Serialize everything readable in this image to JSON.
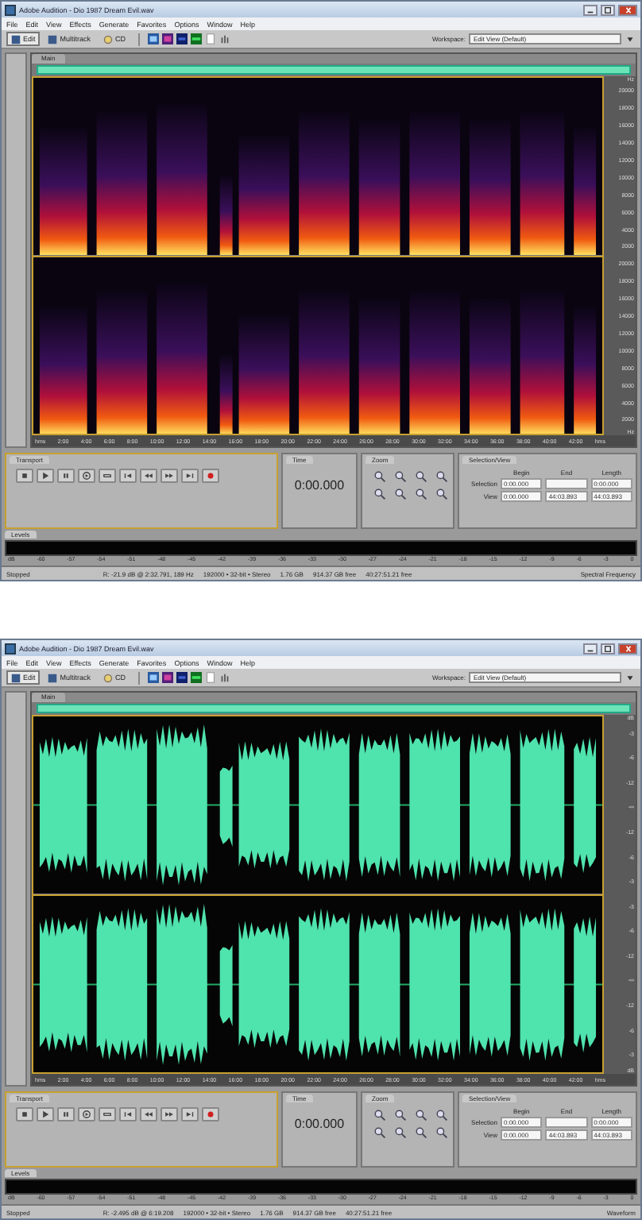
{
  "windows": [
    {
      "title": "Adobe Audition - Dio 1987 Dream Evil.wav",
      "menu": [
        "File",
        "Edit",
        "View",
        "Effects",
        "Generate",
        "Favorites",
        "Options",
        "Window",
        "Help"
      ],
      "toolbar": {
        "modes": [
          {
            "label": "Edit",
            "selected": true
          },
          {
            "label": "Multitrack",
            "selected": false
          },
          {
            "label": "CD",
            "selected": false
          }
        ],
        "workspace_label": "Workspace:",
        "workspace": "Edit View (Default)"
      },
      "main_tab": "Main",
      "display": {
        "kind": "spectral"
      },
      "axis": {
        "unit_top": "Hz",
        "unit_bottom": "Hz",
        "channels": [
          [
            "20000",
            "18000",
            "16000",
            "14000",
            "12000",
            "10000",
            "8000",
            "6000",
            "4000",
            "2000"
          ],
          [
            "20000",
            "18000",
            "16000",
            "14000",
            "12000",
            "10000",
            "8000",
            "6000",
            "4000",
            "2000"
          ]
        ]
      },
      "ruler": [
        "hms",
        "2:00",
        "4:00",
        "6:00",
        "8:00",
        "10:00",
        "12:00",
        "14:00",
        "16:00",
        "18:00",
        "20:00",
        "22:00",
        "24:00",
        "26:00",
        "28:00",
        "30:00",
        "32:00",
        "34:00",
        "36:00",
        "38:00",
        "40:00",
        "42:00",
        "hms"
      ],
      "transport": {
        "title": "Transport"
      },
      "time": {
        "title": "Time",
        "value": "0:00.000"
      },
      "zoom": {
        "title": "Zoom"
      },
      "selection": {
        "title": "Selection/View",
        "columns": [
          "Begin",
          "End",
          "Length"
        ],
        "rows": [
          {
            "label": "Selection",
            "begin": "0:00.000",
            "length": "0:00.000"
          },
          {
            "label": "View",
            "begin": "0:00.000",
            "end": "44:03.893",
            "length": "44:03.893"
          }
        ]
      },
      "levels": {
        "title": "Levels",
        "scale": [
          "dB",
          "-60",
          "-57",
          "-54",
          "-51",
          "-48",
          "-45",
          "-42",
          "-39",
          "-36",
          "-33",
          "-30",
          "-27",
          "-24",
          "-21",
          "-18",
          "-15",
          "-12",
          "-9",
          "-6",
          "-3",
          "0"
        ]
      },
      "status": [
        "Stopped",
        "R: -21.9 dB @ 2:32.791, 189 Hz",
        "192000 • 32-bit • Stereo",
        "1.76 GB",
        "914.37 GB free",
        "40:27:51.21 free",
        "Spectral Frequency"
      ]
    },
    {
      "title": "Adobe Audition - Dio 1987 Dream Evil.wav",
      "menu": [
        "File",
        "Edit",
        "View",
        "Effects",
        "Generate",
        "Favorites",
        "Options",
        "Window",
        "Help"
      ],
      "toolbar": {
        "modes": [
          {
            "label": "Edit",
            "selected": true
          },
          {
            "label": "Multitrack",
            "selected": false
          },
          {
            "label": "CD",
            "selected": false
          }
        ],
        "workspace_label": "Workspace:",
        "workspace": "Edit View (Default)"
      },
      "main_tab": "Main",
      "display": {
        "kind": "waveform"
      },
      "axis": {
        "unit_top": "dB",
        "unit_bottom": "dB",
        "channels": [
          [
            "-3",
            "-6",
            "-12",
            "-∞",
            "-12",
            "-6",
            "-3"
          ],
          [
            "-3",
            "-6",
            "-12",
            "-∞",
            "-12",
            "-6",
            "-3"
          ]
        ]
      },
      "ruler": [
        "hms",
        "2:00",
        "4:00",
        "6:00",
        "8:00",
        "10:00",
        "12:00",
        "14:00",
        "16:00",
        "18:00",
        "20:00",
        "22:00",
        "24:00",
        "26:00",
        "28:00",
        "30:00",
        "32:00",
        "34:00",
        "36:00",
        "38:00",
        "40:00",
        "42:00",
        "hms"
      ],
      "transport": {
        "title": "Transport"
      },
      "time": {
        "title": "Time",
        "value": "0:00.000"
      },
      "zoom": {
        "title": "Zoom"
      },
      "selection": {
        "title": "Selection/View",
        "columns": [
          "Begin",
          "End",
          "Length"
        ],
        "rows": [
          {
            "label": "Selection",
            "begin": "0:00.000",
            "length": "0:00.000"
          },
          {
            "label": "View",
            "begin": "0:00.000",
            "end": "44:03.893",
            "length": "44:03.893"
          }
        ]
      },
      "levels": {
        "title": "Levels",
        "scale": [
          "dB",
          "-60",
          "-57",
          "-54",
          "-51",
          "-48",
          "-45",
          "-42",
          "-39",
          "-36",
          "-33",
          "-30",
          "-27",
          "-24",
          "-21",
          "-18",
          "-15",
          "-12",
          "-9",
          "-6",
          "-3",
          "0"
        ]
      },
      "status": [
        "Stopped",
        "R: -2.495 dB @ 6:19.208",
        "192000 • 32-bit • Stereo",
        "1.76 GB",
        "914.37 GB free",
        "40:27:51.21 free",
        "Waveform"
      ]
    }
  ]
}
